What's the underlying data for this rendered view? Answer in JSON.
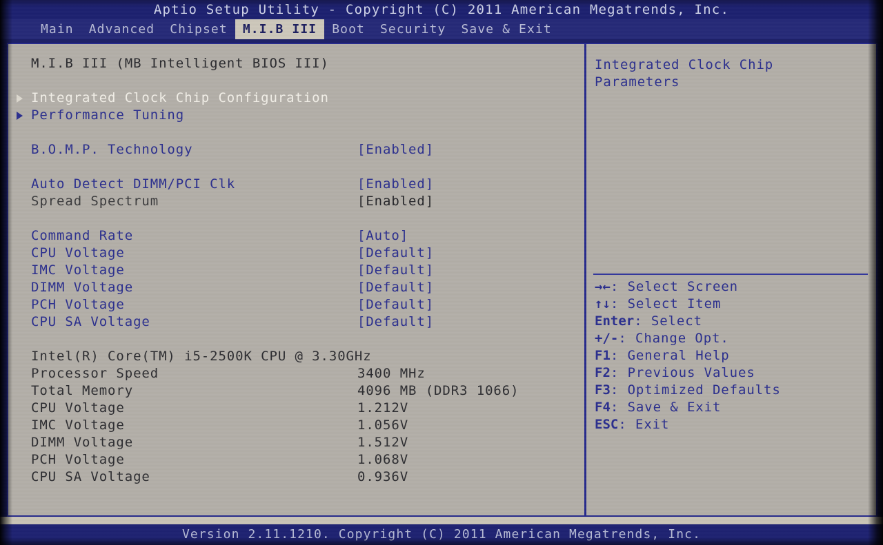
{
  "titlebar": {
    "text": "Aptio Setup Utility - Copyright (C) 2011 American Megatrends, Inc."
  },
  "menubar": {
    "items": [
      {
        "label": "Main",
        "active": false
      },
      {
        "label": "Advanced",
        "active": false
      },
      {
        "label": "Chipset",
        "active": false
      },
      {
        "label": "M.I.B III",
        "active": true
      },
      {
        "label": "Boot",
        "active": false
      },
      {
        "label": "Security",
        "active": false
      },
      {
        "label": "Save & Exit",
        "active": false
      }
    ]
  },
  "main": {
    "heading": "M.I.B III (MB Intelligent BIOS III)",
    "submenus": [
      {
        "label": "Integrated Clock Chip Configuration",
        "selected": true
      },
      {
        "label": "Performance Tuning",
        "selected": false
      }
    ],
    "settings_group_1": [
      {
        "label": "B.O.M.P. Technology",
        "value": "[Enabled]",
        "disabled": false
      }
    ],
    "settings_group_2": [
      {
        "label": "Auto Detect DIMM/PCI Clk",
        "value": "[Enabled]",
        "disabled": false
      },
      {
        "label": "Spread Spectrum",
        "value": "[Enabled]",
        "disabled": true
      }
    ],
    "settings_group_3": [
      {
        "label": "Command Rate",
        "value": "[Auto]",
        "disabled": false
      },
      {
        "label": "CPU Voltage",
        "value": "[Default]",
        "disabled": false
      },
      {
        "label": "IMC Voltage",
        "value": "[Default]",
        "disabled": false
      },
      {
        "label": "DIMM Voltage",
        "value": "[Default]",
        "disabled": false
      },
      {
        "label": "PCH Voltage",
        "value": "[Default]",
        "disabled": false
      },
      {
        "label": "CPU SA Voltage",
        "value": "[Default]",
        "disabled": false
      }
    ],
    "system_info": {
      "cpu_name": "Intel(R) Core(TM) i5-2500K CPU @ 3.30GHz",
      "rows": [
        {
          "label": "Processor Speed",
          "value": "3400 MHz"
        },
        {
          "label": "Total Memory",
          "value": "4096 MB (DDR3 1066)"
        },
        {
          "label": "CPU Voltage",
          "value": "1.212V"
        },
        {
          "label": "IMC Voltage",
          "value": "1.056V"
        },
        {
          "label": "DIMM Voltage",
          "value": "1.512V"
        },
        {
          "label": "PCH Voltage",
          "value": "1.068V"
        },
        {
          "label": "CPU SA Voltage",
          "value": "0.936V"
        }
      ]
    }
  },
  "help": {
    "text": "Integrated Clock Chip\nParameters",
    "keys": [
      {
        "glyph": "→←",
        "text": ": Select Screen"
      },
      {
        "glyph": "↑↓",
        "text": ": Select Item"
      },
      {
        "glyph": "Enter",
        "text": ": Select"
      },
      {
        "glyph": "+/-",
        "text": ": Change Opt."
      },
      {
        "glyph": "F1",
        "text": ": General Help"
      },
      {
        "glyph": "F2",
        "text": ": Previous Values"
      },
      {
        "glyph": "F3",
        "text": ": Optimized Defaults"
      },
      {
        "glyph": "F4",
        "text": ": Save & Exit"
      },
      {
        "glyph": "ESC",
        "text": ": Exit"
      }
    ]
  },
  "footer": {
    "text": "Version 2.11.1210. Copyright (C) 2011 American Megatrends, Inc."
  },
  "colors": {
    "screen_blue": "#1d2170",
    "panel_bg": "#b3afa8",
    "frame_blue": "#262a8c",
    "text_blue": "#2b2f8e",
    "text_dim": "#2d2d31",
    "selected_text": "#f2efe8",
    "active_tab_bg": "#cdc8bb"
  }
}
